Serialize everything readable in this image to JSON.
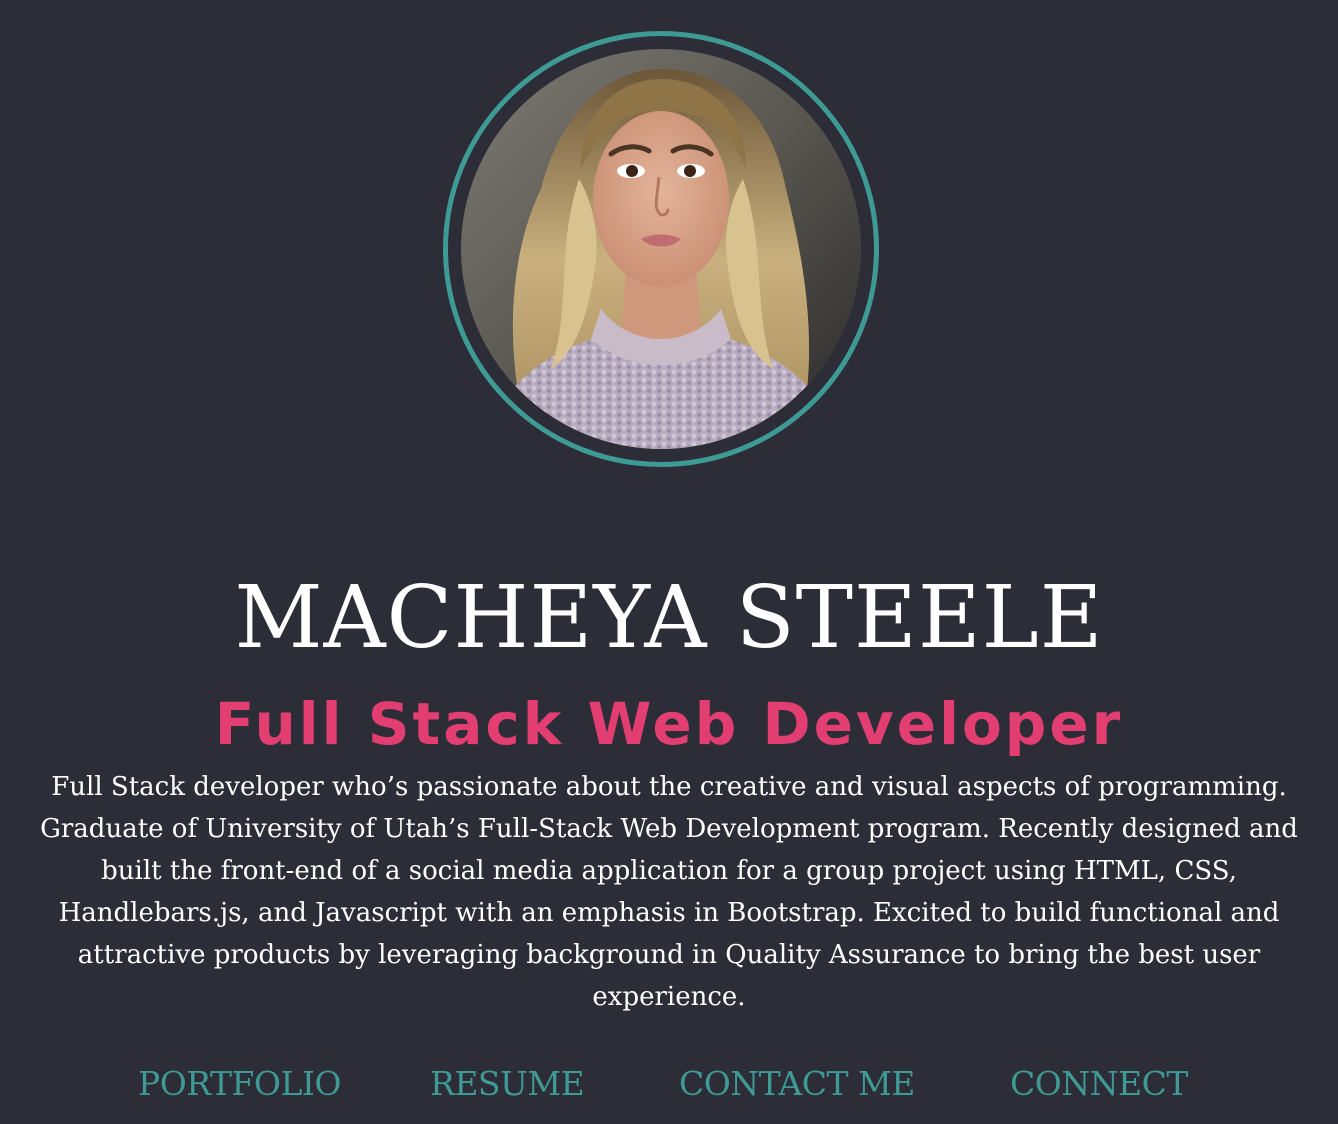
{
  "profile": {
    "name": "MACHEYA STEELE",
    "role": "Full Stack Web Developer",
    "bio": "Full Stack developer who’s passionate about the creative and visual aspects of programming. Graduate of University of Utah’s Full-Stack Web Development program. Recently designed and built the front-end of a social media application for a group project using HTML, CSS, Handlebars.js, and Javascript with an emphasis in Bootstrap. Excited to build functional and attractive products by leveraging background in Quality Assurance to bring the best user experience."
  },
  "nav": {
    "items": [
      {
        "label": "PORTFOLIO"
      },
      {
        "label": "RESUME"
      },
      {
        "label": "CONTACT ME"
      },
      {
        "label": "CONNECT"
      }
    ]
  },
  "colors": {
    "background": "#2d2d38",
    "accent_teal": "#3e9a94",
    "accent_pink": "#e23e72",
    "text": "#ffffff"
  }
}
